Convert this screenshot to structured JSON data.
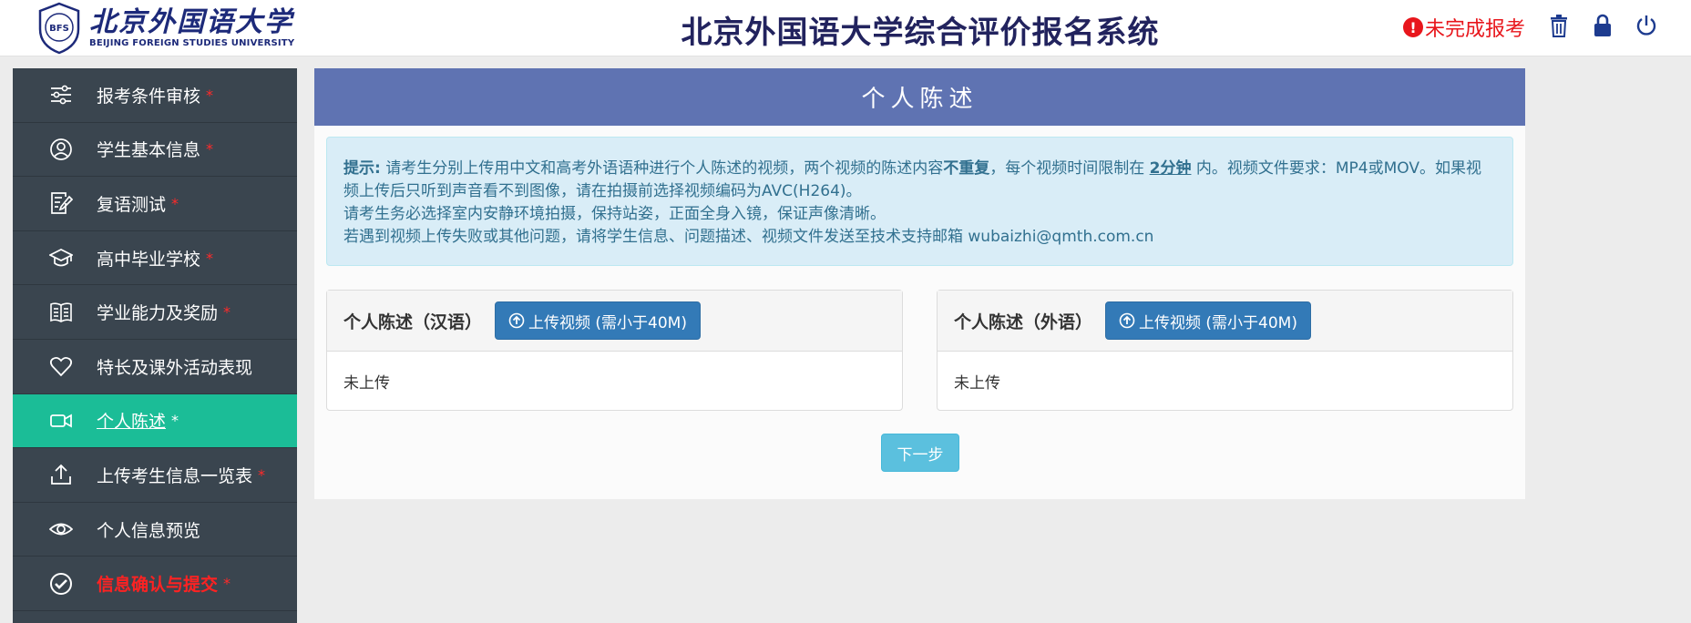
{
  "header": {
    "logo_cn": "北京外国语大学",
    "logo_en": "BEIJING FOREIGN STUDIES UNIVERSITY",
    "seal_letters": "BFS",
    "title": "北京外国语大学综合评价报名系统",
    "status_text": "未完成报考",
    "status_color": "#e8161c",
    "icons": [
      "trash-icon",
      "lock-icon",
      "power-icon"
    ]
  },
  "sidebar": {
    "items": [
      {
        "label": "报考条件审核",
        "required": "*",
        "icon": "sliders-icon"
      },
      {
        "label": "学生基本信息",
        "required": "*",
        "icon": "user-circle-icon"
      },
      {
        "label": "复语测试",
        "required": "*",
        "icon": "edit-document-icon"
      },
      {
        "label": "高中毕业学校",
        "required": "*",
        "icon": "graduation-cap-icon"
      },
      {
        "label": "学业能力及奖励",
        "required": "*",
        "icon": "open-book-icon"
      },
      {
        "label": "特长及课外活动表现",
        "required": "",
        "icon": "heart-icon"
      },
      {
        "label": "个人陈述",
        "required": "*",
        "icon": "video-camera-icon",
        "active": true
      },
      {
        "label": "上传考生信息一览表",
        "required": "*",
        "icon": "upload-icon"
      },
      {
        "label": "个人信息预览",
        "required": "",
        "icon": "eye-icon"
      },
      {
        "label": "信息确认与提交",
        "required": "*",
        "icon": "check-circle-icon"
      }
    ],
    "active_color": "#1bbd97"
  },
  "main": {
    "panel_title": "个人陈述",
    "notice": {
      "tip_label": "提示:",
      "line1_a": "请考生分别上传用中文和高考外语语种进行个人陈述的视频，两个视频的陈述内容",
      "line1_bold": "不重复",
      "line1_b": "，每个视频时间限制在 ",
      "line1_limit": "2分钟",
      "line1_c": " 内。视频文件要求：MP4或MOV。如果视频上传后只听到声音看不到图像，请在拍摄前选择视频编码为AVC(H264)。",
      "line2": "请考生务必选择室内安静环境拍摄，保持站姿，正面全身入镜，保证声像清晰。",
      "line3": "若遇到视频上传失败或其他问题，请将学生信息、问题描述、视频文件发送至技术支持邮箱 wubaizhi@qmth.com.cn"
    },
    "cards": [
      {
        "title": "个人陈述（汉语）",
        "button": "上传视频 (需小于40M)",
        "status": "未上传"
      },
      {
        "title": "个人陈述（外语）",
        "button": "上传视频 (需小于40M)",
        "status": "未上传"
      }
    ],
    "next_button": "下一步",
    "header_color": "#5f73b2"
  }
}
